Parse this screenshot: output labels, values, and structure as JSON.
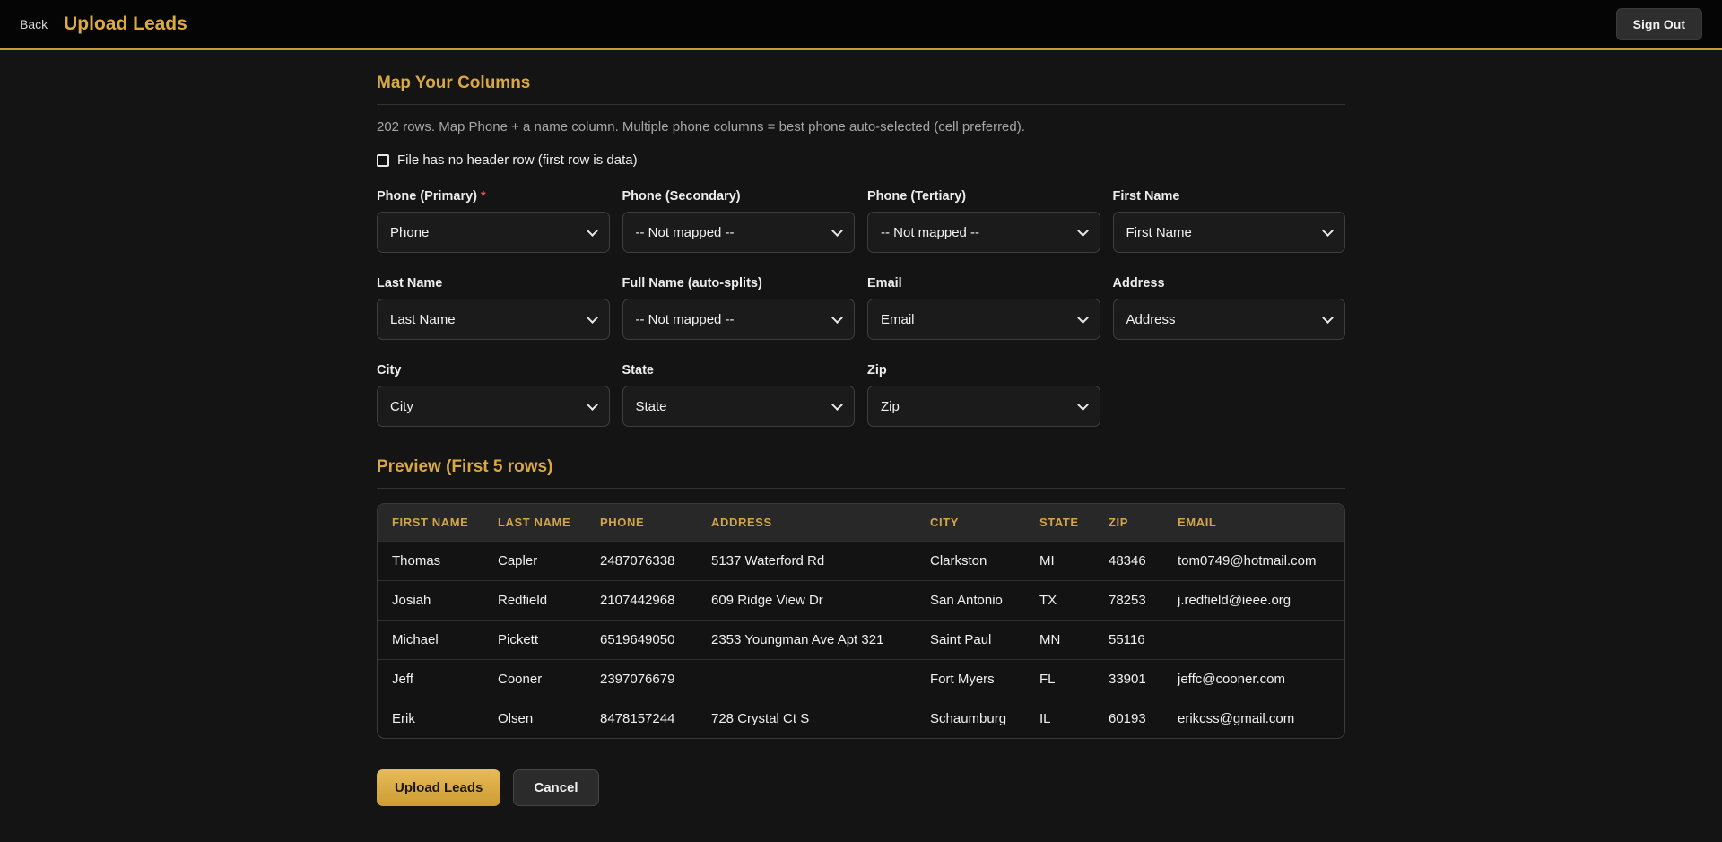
{
  "header": {
    "back_label": "Back",
    "title": "Upload Leads",
    "sign_out_label": "Sign Out"
  },
  "mapping": {
    "heading": "Map Your Columns",
    "subtext": "202 rows. Map Phone + a name column. Multiple phone columns = best phone auto-selected (cell preferred).",
    "checkbox_label": "File has no header row (first row is data)",
    "checkbox_checked": false,
    "fields": [
      {
        "label": "Phone (Primary)",
        "required": true,
        "value": "Phone"
      },
      {
        "label": "Phone (Secondary)",
        "required": false,
        "value": "-- Not mapped --"
      },
      {
        "label": "Phone (Tertiary)",
        "required": false,
        "value": "-- Not mapped --"
      },
      {
        "label": "First Name",
        "required": false,
        "value": "First Name"
      },
      {
        "label": "Last Name",
        "required": false,
        "value": "Last Name"
      },
      {
        "label": "Full Name (auto-splits)",
        "required": false,
        "value": "-- Not mapped --"
      },
      {
        "label": "Email",
        "required": false,
        "value": "Email"
      },
      {
        "label": "Address",
        "required": false,
        "value": "Address"
      },
      {
        "label": "City",
        "required": false,
        "value": "City"
      },
      {
        "label": "State",
        "required": false,
        "value": "State"
      },
      {
        "label": "Zip",
        "required": false,
        "value": "Zip"
      }
    ]
  },
  "preview": {
    "heading": "Preview (First 5 rows)",
    "columns": [
      "First Name",
      "Last Name",
      "Phone",
      "Address",
      "City",
      "State",
      "Zip",
      "Email"
    ],
    "rows": [
      [
        "Thomas",
        "Capler",
        "2487076338",
        "5137 Waterford Rd",
        "Clarkston",
        "MI",
        "48346",
        "tom0749@hotmail.com"
      ],
      [
        "Josiah",
        "Redfield",
        "2107442968",
        "609 Ridge View Dr",
        "San Antonio",
        "TX",
        "78253",
        "j.redfield@ieee.org"
      ],
      [
        "Michael",
        "Pickett",
        "6519649050",
        "2353 Youngman Ave Apt 321",
        "Saint Paul",
        "MN",
        "55116",
        ""
      ],
      [
        "Jeff",
        "Cooner",
        "2397076679",
        "",
        "Fort Myers",
        "FL",
        "33901",
        "jeffc@cooner.com"
      ],
      [
        "Erik",
        "Olsen",
        "8478157244",
        "728 Crystal Ct S",
        "Schaumburg",
        "IL",
        "60193",
        "erikcss@gmail.com"
      ]
    ]
  },
  "actions": {
    "upload_label": "Upload Leads",
    "cancel_label": "Cancel"
  },
  "colors": {
    "accent_gold": "#d9a843",
    "button_gold": "#d8ab45",
    "required_red": "#e05b52",
    "header_bg": "#050505",
    "content_bg": "#141414",
    "table_header_bg": "#282828"
  }
}
